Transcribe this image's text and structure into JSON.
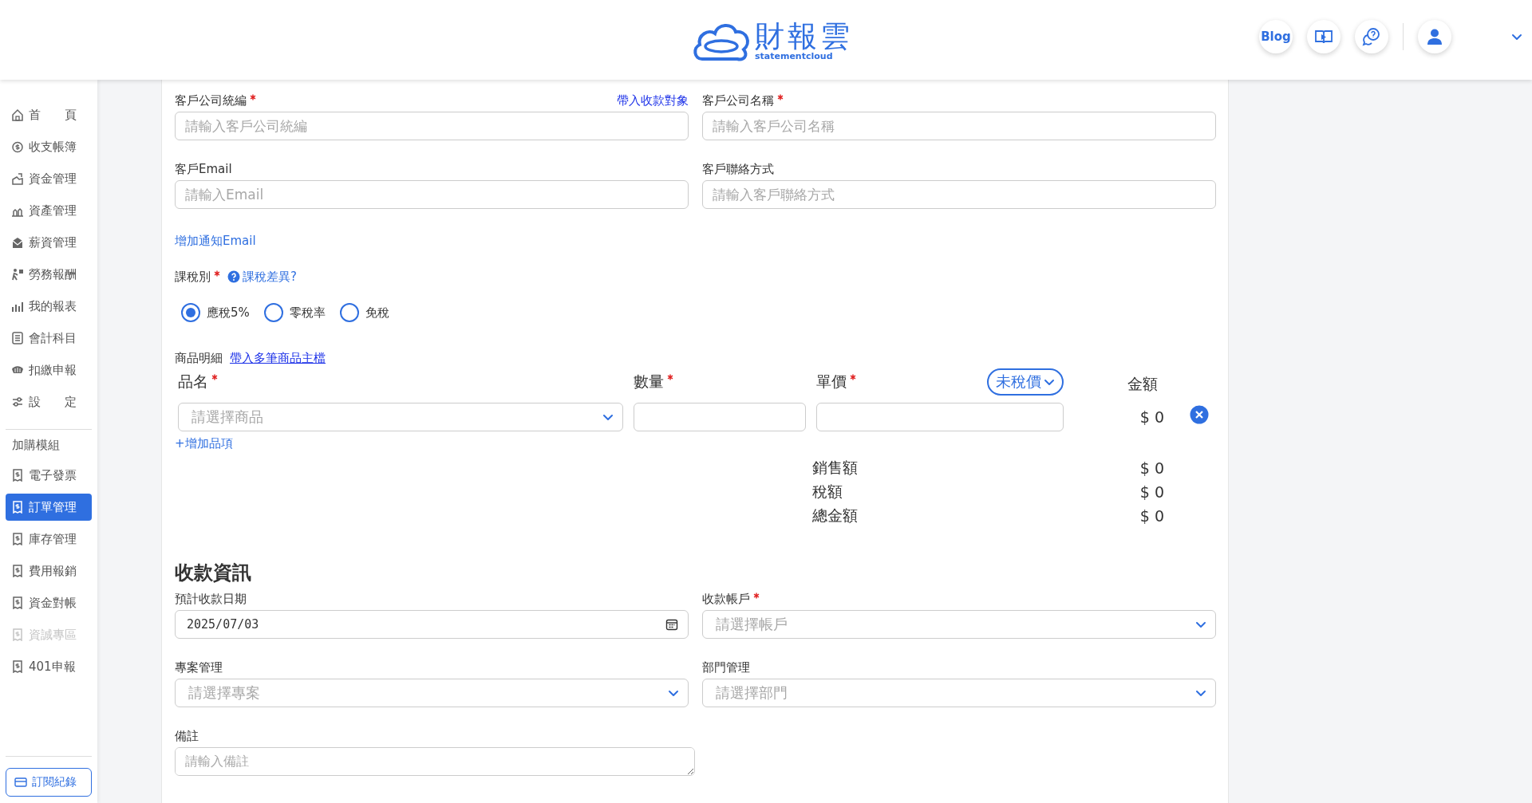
{
  "header": {
    "logo": {
      "title": "財報雲",
      "subtitle": "statementcloud"
    },
    "blog_button": "Blog"
  },
  "sidebar": {
    "items": [
      {
        "label": "首　　頁",
        "selected": false,
        "disabled": false
      },
      {
        "label": "收支帳簿",
        "selected": false,
        "disabled": false
      },
      {
        "label": "資金管理",
        "selected": false,
        "disabled": false
      },
      {
        "label": "資產管理",
        "selected": false,
        "disabled": false
      },
      {
        "label": "薪資管理",
        "selected": false,
        "disabled": false
      },
      {
        "label": "勞務報酬",
        "selected": false,
        "disabled": false
      },
      {
        "label": "我的報表",
        "selected": false,
        "disabled": false
      },
      {
        "label": "會計科目",
        "selected": false,
        "disabled": false
      },
      {
        "label": "扣繳申報",
        "selected": false,
        "disabled": false
      },
      {
        "label": "設　　定",
        "selected": false,
        "disabled": false
      }
    ],
    "module_heading": "加購模組",
    "modules": [
      {
        "label": "電子發票",
        "selected": false,
        "disabled": false
      },
      {
        "label": "訂單管理",
        "selected": true,
        "disabled": false
      },
      {
        "label": "庫存管理",
        "selected": false,
        "disabled": false
      },
      {
        "label": "費用報銷",
        "selected": false,
        "disabled": false
      },
      {
        "label": "資金對帳",
        "selected": false,
        "disabled": false
      },
      {
        "label": "資誠專區",
        "selected": false,
        "disabled": true
      },
      {
        "label": "401申報",
        "selected": false,
        "disabled": false
      }
    ],
    "bottom_button": "訂閱紀錄"
  },
  "customer": {
    "fields": [
      {
        "label": "客戶公司統編",
        "required": true,
        "placeholder": "請輸入客戶公司統編",
        "link": "帶入收款對象"
      },
      {
        "label": "客戶公司名稱",
        "required": true,
        "placeholder": "請輸入客戶公司名稱"
      },
      {
        "label": "客戶Email",
        "required": false,
        "placeholder": "請輸入Email"
      },
      {
        "label": "客戶聯絡方式",
        "required": false,
        "placeholder": "請輸入客戶聯絡方式"
      }
    ],
    "add_email_link": "增加通知Email"
  },
  "tax": {
    "label": "課稅別",
    "required": true,
    "help_link": "課稅差異?",
    "options": [
      {
        "label": "應稅5%",
        "selected": true
      },
      {
        "label": "零稅率",
        "selected": false
      },
      {
        "label": "免稅",
        "selected": false
      }
    ]
  },
  "products": {
    "title": "商品明細",
    "import_link": "帶入多筆商品主檔",
    "columns": [
      {
        "label": "品名",
        "required": true
      },
      {
        "label": "數量",
        "required": true
      },
      {
        "label": "單價",
        "required": true
      },
      {
        "label": "金額",
        "required": false
      }
    ],
    "price_mode": "未稅價",
    "rows": [
      {
        "product_placeholder": "請選擇商品",
        "amount": "$ 0"
      }
    ],
    "add_item_link": "+增加品項",
    "totals": [
      {
        "label": "銷售額",
        "value": "$ 0"
      },
      {
        "label": "稅額",
        "value": "$ 0"
      },
      {
        "label": "總金額",
        "value": "$ 0"
      }
    ]
  },
  "payment": {
    "title": "收款資訊",
    "fields": [
      {
        "kind": "date",
        "label": "預計收款日期",
        "required": false,
        "value": "2025/07/03"
      },
      {
        "kind": "select",
        "label": "收款帳戶",
        "required": true,
        "placeholder": "請選擇帳戶"
      },
      {
        "kind": "select",
        "label": "專案管理",
        "required": false,
        "placeholder": "請選擇專案"
      },
      {
        "kind": "select",
        "label": "部門管理",
        "required": false,
        "placeholder": "請選擇部門"
      },
      {
        "kind": "textarea",
        "label": "備註",
        "required": false,
        "placeholder": "請輸入備註"
      }
    ]
  }
}
